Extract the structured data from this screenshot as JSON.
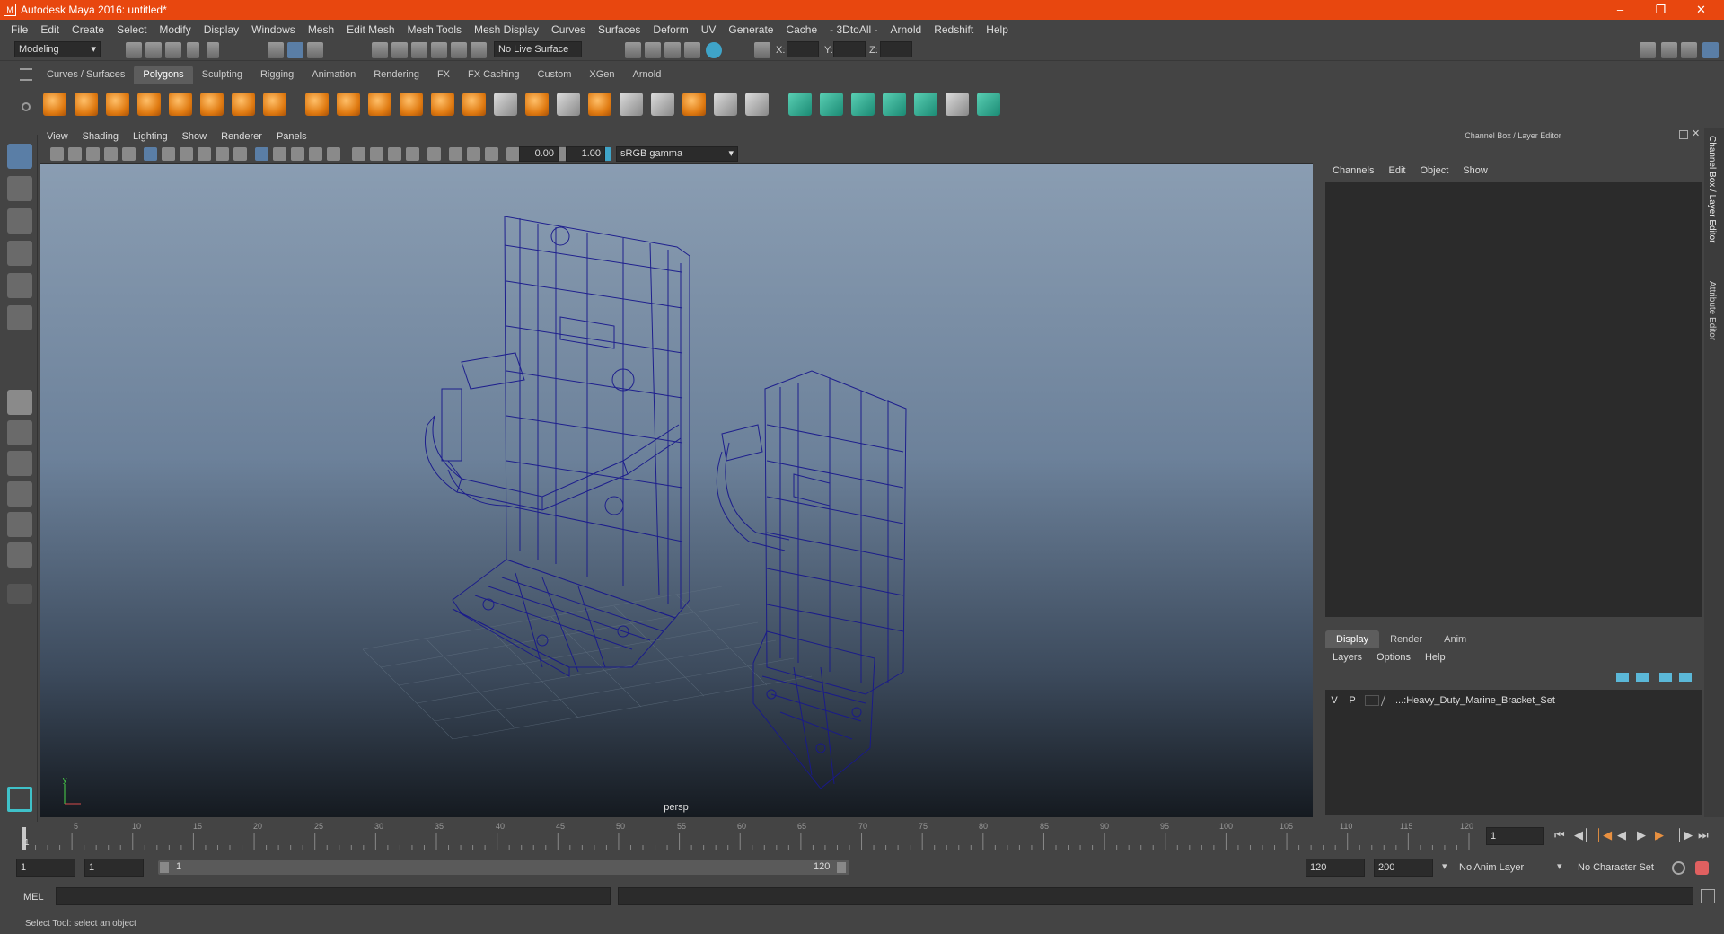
{
  "window": {
    "title": "Autodesk Maya 2016: untitled*"
  },
  "menubar": [
    "File",
    "Edit",
    "Create",
    "Select",
    "Modify",
    "Display",
    "Windows",
    "Mesh",
    "Edit Mesh",
    "Mesh Tools",
    "Mesh Display",
    "Curves",
    "Surfaces",
    "Deform",
    "UV",
    "Generate",
    "Cache",
    "- 3DtoAll -",
    "Arnold",
    "Redshift",
    "Help"
  ],
  "statusline": {
    "menuset": "Modeling",
    "live_surface": "No Live Surface",
    "x_label": "X:",
    "y_label": "Y:",
    "z_label": "Z:"
  },
  "shelf_tabs": [
    "Curves / Surfaces",
    "Polygons",
    "Sculpting",
    "Rigging",
    "Animation",
    "Rendering",
    "FX",
    "FX Caching",
    "Custom",
    "XGen",
    "Arnold"
  ],
  "active_shelf": "Polygons",
  "viewport": {
    "menu": [
      "View",
      "Shading",
      "Lighting",
      "Show",
      "Renderer",
      "Panels"
    ],
    "exposure": "0.00",
    "gamma": "1.00",
    "colorspace": "sRGB gamma",
    "camera": "persp"
  },
  "channel_box": {
    "title": "Channel Box / Layer Editor",
    "menu": [
      "Channels",
      "Edit",
      "Object",
      "Show"
    ]
  },
  "layer_editor": {
    "tabs": [
      "Display",
      "Render",
      "Anim"
    ],
    "active_tab": "Display",
    "menu": [
      "Layers",
      "Options",
      "Help"
    ],
    "layers": [
      {
        "v": "V",
        "p": "P",
        "name": "...:Heavy_Duty_Marine_Bracket_Set"
      }
    ]
  },
  "side_tabs": [
    "Channel Box / Layer Editor",
    "Attribute Editor"
  ],
  "timeslider": {
    "labels": [
      "5",
      "10",
      "15",
      "20",
      "25",
      "30",
      "35",
      "40",
      "45",
      "50",
      "55",
      "60",
      "65",
      "70",
      "75",
      "80",
      "85",
      "90",
      "95",
      "100",
      "105",
      "110",
      "115",
      "120"
    ],
    "current_frame": "1",
    "frame_field": "1"
  },
  "range": {
    "start": "1",
    "anim_start": "1",
    "range_start_label": "1",
    "range_end_label": "120",
    "end": "120",
    "anim_end": "200",
    "anim_layer": "No Anim Layer",
    "char_set": "No Character Set"
  },
  "cmdline": {
    "label": "MEL"
  },
  "helpline": {
    "text": "Select Tool: select an object"
  },
  "colors": {
    "titlebar": "#e8470f",
    "wire": "#1a1a8c",
    "accent": "#5d5d5d"
  }
}
